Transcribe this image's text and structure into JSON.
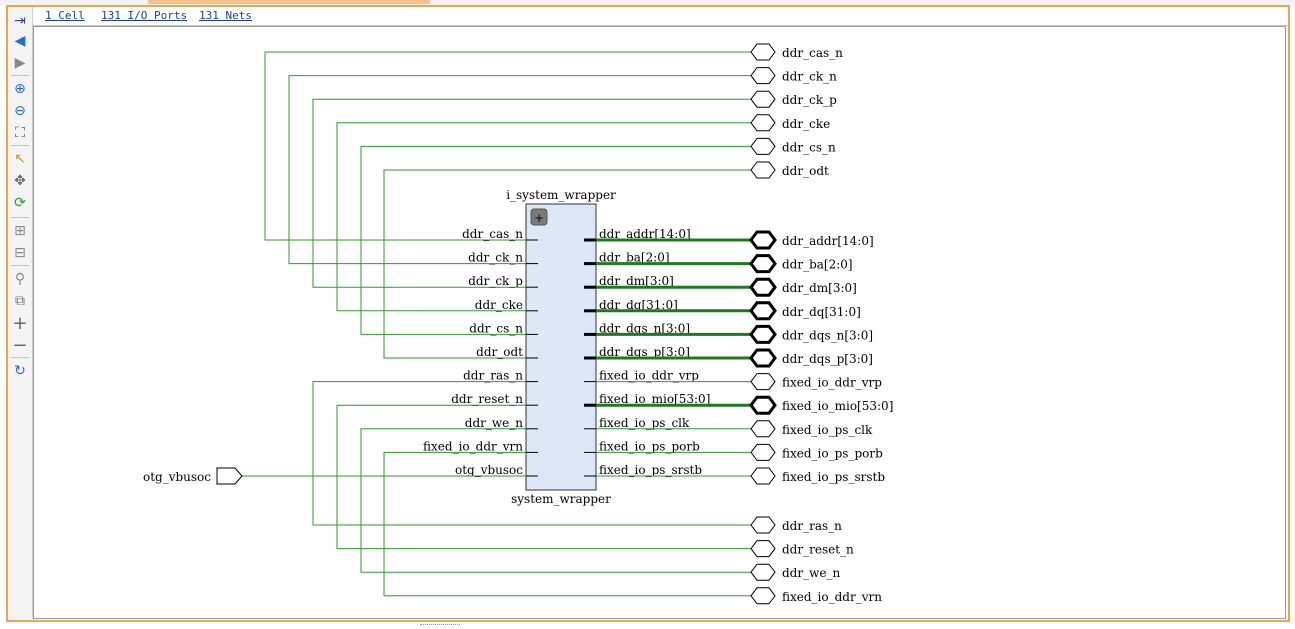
{
  "header": {
    "cells": "1 Cell",
    "io_ports": "131 I/O Ports",
    "nets": "131 Nets"
  },
  "toolbar": [
    {
      "name": "collapse-panel-icon",
      "glyph": "⇥"
    },
    {
      "name": "back-arrow-icon",
      "glyph": "◀"
    },
    {
      "name": "forward-arrow-icon",
      "glyph": "▶"
    },
    {
      "name": "zoom-in-icon",
      "glyph": "⊕"
    },
    {
      "name": "zoom-out-icon",
      "glyph": "⊖"
    },
    {
      "name": "zoom-fit-icon",
      "glyph": "⛶"
    },
    {
      "name": "select-cursor-icon",
      "glyph": "↖"
    },
    {
      "name": "move-icon",
      "glyph": "✥"
    },
    {
      "name": "regenerate-icon",
      "glyph": "⟳"
    },
    {
      "name": "expand-cell-icon",
      "glyph": "⊞"
    },
    {
      "name": "collapse-cell-icon",
      "glyph": "⊟"
    },
    {
      "name": "search-icon",
      "glyph": "⚲"
    },
    {
      "name": "copy-icon",
      "glyph": "⧉"
    },
    {
      "name": "plus-icon",
      "glyph": "+"
    },
    {
      "name": "minus-icon",
      "glyph": "−"
    },
    {
      "name": "refresh-icon",
      "glyph": "↻"
    }
  ],
  "cell": {
    "instance_name": "i_system_wrapper",
    "module_name": "system_wrapper",
    "expand_glyph": "+",
    "left_pins": [
      "ddr_cas_n",
      "ddr_ck_n",
      "ddr_ck_p",
      "ddr_cke",
      "ddr_cs_n",
      "ddr_odt",
      "ddr_ras_n",
      "ddr_reset_n",
      "ddr_we_n",
      "fixed_io_ddr_vrn",
      "otg_vbusoc"
    ],
    "right_pins": [
      {
        "name": "ddr_addr[14:0]",
        "bus": true
      },
      {
        "name": "ddr_ba[2:0]",
        "bus": true
      },
      {
        "name": "ddr_dm[3:0]",
        "bus": true
      },
      {
        "name": "ddr_dq[31:0]",
        "bus": true
      },
      {
        "name": "ddr_dqs_n[3:0]",
        "bus": true
      },
      {
        "name": "ddr_dqs_p[3:0]",
        "bus": true
      },
      {
        "name": "fixed_io_ddr_vrp",
        "bus": false
      },
      {
        "name": "fixed_io_mio[53:0]",
        "bus": true
      },
      {
        "name": "fixed_io_ps_clk",
        "bus": false
      },
      {
        "name": "fixed_io_ps_porb",
        "bus": false
      },
      {
        "name": "fixed_io_ps_srstb",
        "bus": false
      }
    ]
  },
  "ports_top": [
    "ddr_cas_n",
    "ddr_ck_n",
    "ddr_ck_p",
    "ddr_cke",
    "ddr_cs_n",
    "ddr_odt"
  ],
  "ports_bottom": [
    "ddr_ras_n",
    "ddr_reset_n",
    "ddr_we_n",
    "fixed_io_ddr_vrn"
  ],
  "input_port": "otg_vbusoc",
  "colors": {
    "net": "#2e9a2e",
    "bus_net": "#1f7a1f",
    "cell_fill": "#dce8f6",
    "cell_border": "#333333",
    "accent": "#f0a44a"
  }
}
